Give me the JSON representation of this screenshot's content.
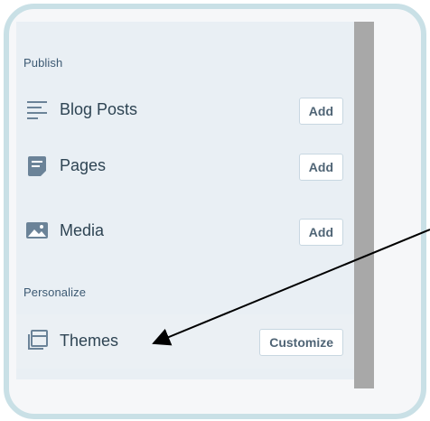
{
  "sections": {
    "publish": "Publish",
    "personalize": "Personalize"
  },
  "items": [
    {
      "label": "Blog Posts",
      "button": "Add",
      "icon": "blog-posts-icon"
    },
    {
      "label": "Pages",
      "button": "Add",
      "icon": "pages-icon"
    },
    {
      "label": "Media",
      "button": "Add",
      "icon": "media-icon"
    },
    {
      "label": "Themes",
      "button": "Customize",
      "icon": "themes-icon"
    }
  ],
  "colors": {
    "frame_border": "#c9e0e6",
    "sidebar_bg": "#e9eff4",
    "icon": "#6b8398",
    "text": "#2e4453"
  }
}
